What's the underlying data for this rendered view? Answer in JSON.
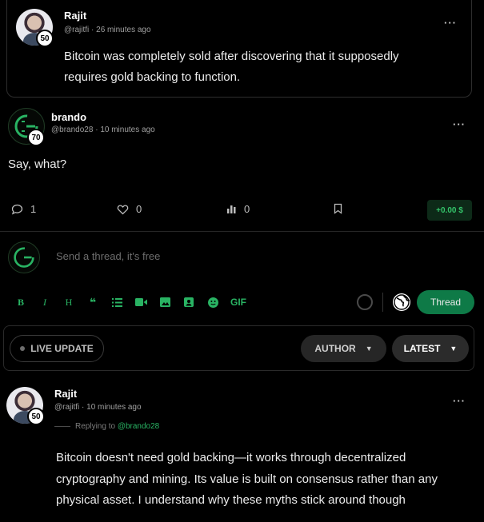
{
  "quoted_post": {
    "author_name": "Rajit",
    "handle": "@rajitfi",
    "time": "26 minutes ago",
    "level": "50",
    "text_line1": "Bitcoin was completely sold after discovering that it supposedly",
    "text_line2": "requires gold backing to function.",
    "more_icon": "more-horizontal-icon"
  },
  "main_post": {
    "author_name": "brando",
    "handle": "@brando28",
    "time": "10 minutes ago",
    "level": "70",
    "text": "Say, what?",
    "replies": "1",
    "likes": "0",
    "views": "0",
    "tip": "+0.00 $",
    "more_icon": "more-horizontal-icon"
  },
  "composer": {
    "placeholder": "Send a thread, it's free",
    "tools": [
      "B",
      "I",
      "H",
      "66",
      "list",
      "video",
      "image",
      "media",
      "emoji",
      "GIF"
    ],
    "gif_label": "GIF",
    "submit_label": "Thread"
  },
  "filters": {
    "live_label": "LIVE UPDATE",
    "author_label": "AUTHOR",
    "latest_label": "LATEST"
  },
  "reply_post": {
    "author_name": "Rajit",
    "handle": "@rajitfi",
    "time": "10 minutes ago",
    "level": "50",
    "replying_prefix": "Replying to",
    "replying_to": "@brando28",
    "text_line1": "Bitcoin doesn't need gold backing—it works through decentralized",
    "text_line2": "cryptography and mining. Its value is built on consensus rather than any",
    "text_line3": "physical asset. I understand why these myths stick around though"
  },
  "colors": {
    "accent": "#29b363",
    "thread_button": "#0e7a47",
    "background": "#000000"
  }
}
